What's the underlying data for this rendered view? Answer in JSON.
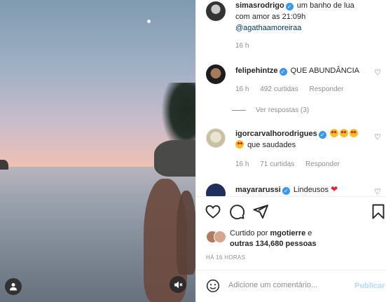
{
  "post": {
    "author": "simasrodrigo",
    "caption_line1": "um banho de lua",
    "caption_line2": "com amor as 21:09h",
    "caption_mention": "@agathaamoreiraa",
    "caption_time": "16 h"
  },
  "comments": [
    {
      "username": "felipehintze",
      "text": "QUE ABUNDÂNCIA",
      "time": "16 h",
      "likes": "492 curtidas",
      "reply": "Responder",
      "view_replies": "Ver respostas (3)"
    },
    {
      "username": "igorcarvalhorodrigues",
      "text": "que saudades",
      "time": "16 h",
      "likes": "71 curtidas",
      "reply": "Responder"
    },
    {
      "username": "mayararussi",
      "text": "Lindeusos"
    }
  ],
  "likes": {
    "prefix": "Curtido por ",
    "user": "mgotierre",
    "suffix": " e",
    "line2": "outras 134,680 pessoas"
  },
  "time_ago": "HÁ 16 HORAS",
  "comment_box": {
    "placeholder": "Adicione um comentário...",
    "publish": "Publicar"
  },
  "icons": {
    "like": "heart-outline-icon",
    "comment": "comment-bubble-icon",
    "share": "paper-plane-icon",
    "save": "bookmark-icon",
    "emoji": "smiley-icon",
    "user_tag": "user-icon",
    "mute": "speaker-muted-icon"
  },
  "colors": {
    "verified": "#3897f0",
    "publish_disabled": "#b3dbff",
    "heart_red": "#ed1d3a"
  }
}
